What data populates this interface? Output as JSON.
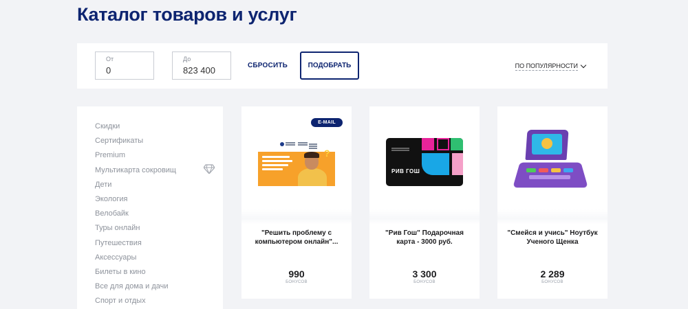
{
  "page": {
    "title": "Каталог товаров и услуг"
  },
  "filters": {
    "from_label": "От",
    "from_value": "0",
    "to_label": "До",
    "to_value": "823 400",
    "reset_label": "СБРОСИТЬ",
    "apply_label": "ПОДОБРАТЬ",
    "sort_label": "ПО ПОПУЛЯРНОСТИ"
  },
  "sidebar": {
    "items": [
      {
        "label": "Скидки"
      },
      {
        "label": "Сертификаты"
      },
      {
        "label": "Premium"
      },
      {
        "label": "Мультикарта сокровищ",
        "icon": "diamond-icon"
      },
      {
        "label": "Дети"
      },
      {
        "label": "Экология"
      },
      {
        "label": "Велобайк"
      },
      {
        "label": "Туры онлайн"
      },
      {
        "label": "Путешествия"
      },
      {
        "label": "Аксессуары"
      },
      {
        "label": "Билеты в кино"
      },
      {
        "label": "Все для дома и дачи"
      },
      {
        "label": "Спорт и отдых"
      }
    ]
  },
  "products": [
    {
      "badge": "E-MAIL",
      "name": "\"Решить проблему с компьютером онлайн\"...",
      "price": "990",
      "unit": "БОНУСОВ",
      "image": "computer-help-promo-image"
    },
    {
      "name": "\"Рив Гош\" Подарочная карта - 3000 руб.",
      "price": "3 300",
      "unit": "БОНУСОВ",
      "image": "riv-gauche-gift-card-image",
      "image_text": "РИВ ГОШ"
    },
    {
      "name": "\"Смейся и учись\" Ноутбук Ученого Щенка",
      "price": "2 289",
      "unit": "БОНУСОВ",
      "image": "toy-laptop-image"
    }
  ],
  "colors": {
    "accent": "#0d2470",
    "background": "#f2f3f6",
    "muted_text": "#8d929b"
  }
}
